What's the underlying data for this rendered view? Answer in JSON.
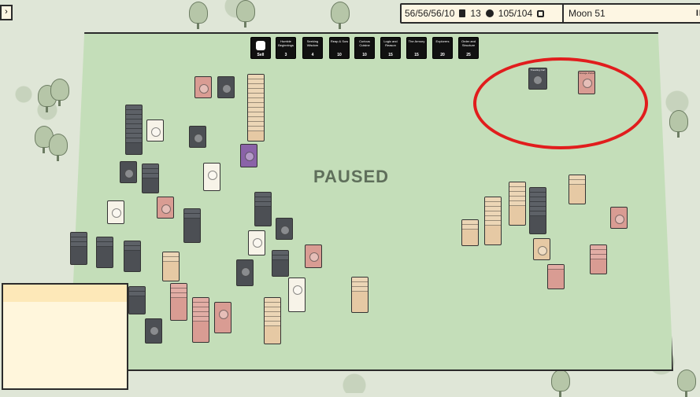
{
  "hud": {
    "resources": {
      "food": "56/56/56/10",
      "coins": "13",
      "cards": "105/104"
    },
    "moon": "Moon 51",
    "pause_glyph": "II"
  },
  "board": {
    "paused_label": "PAUSED"
  },
  "shop": [
    {
      "label": "Sell",
      "price": ""
    },
    {
      "label": "Humble Beginnings",
      "price": "3"
    },
    {
      "label": "Seeking Wisdom",
      "price": "4"
    },
    {
      "label": "Reap & Sow",
      "price": "10"
    },
    {
      "label": "Curious Cuisine",
      "price": "10"
    },
    {
      "label": "Logic and Reason",
      "price": "15"
    },
    {
      "label": "The Armory",
      "price": "15"
    },
    {
      "label": "Explorers",
      "price": "20"
    },
    {
      "label": "Order and Structure",
      "price": "25"
    }
  ],
  "highlight_cards": [
    {
      "label": "Traveling Cart"
    },
    {
      "label": "Strange Portal"
    }
  ]
}
